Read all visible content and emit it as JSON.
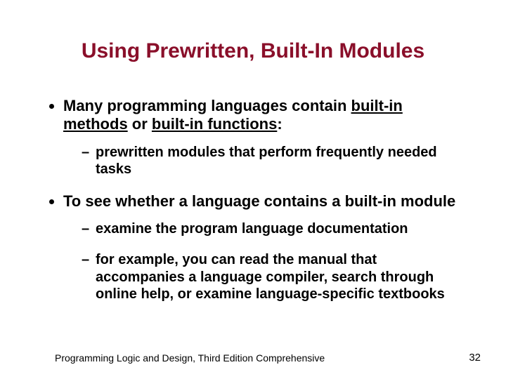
{
  "title": "Using Prewritten, Built-In Modules",
  "bullets": {
    "b1_pre": "Many programming languages contain ",
    "b1_u1": "built-in methods",
    "b1_mid": " or ",
    "b1_u2": "built-in functions",
    "b1_post": ":",
    "b1_sub1": "prewritten modules that perform frequently needed tasks",
    "b2": "To see whether a language contains a built-in module",
    "b2_sub1": "examine the program language documentation",
    "b2_sub2": "for example, you can read the manual that accompanies a language compiler, search through online help, or examine language-specific textbooks"
  },
  "footer": {
    "text": "Programming Logic and Design, Third Edition Comprehensive",
    "page": "32"
  }
}
